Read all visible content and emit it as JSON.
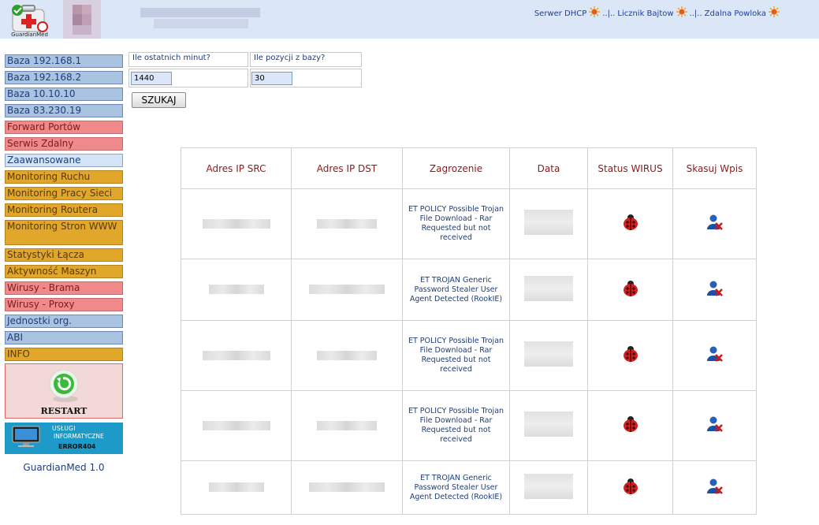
{
  "header": {
    "logo_text": "GuardianMed",
    "nav": [
      {
        "label": "Serwer DHCP"
      },
      {
        "label": "Licznik Bajtow"
      },
      {
        "label": "Zdalna Powloka"
      }
    ],
    "separator": "..|.."
  },
  "sidebar": {
    "items": [
      {
        "label": "Baza 192.168.1",
        "style": "blue"
      },
      {
        "label": "Baza 192.168.2",
        "style": "blue"
      },
      {
        "label": "Baza 10.10.10",
        "style": "blue"
      },
      {
        "label": "Baza 83.230.19",
        "style": "blue"
      },
      {
        "label": "Forward Portów",
        "style": "pink"
      },
      {
        "label": "Serwis Zdalny",
        "style": "pink"
      },
      {
        "label": "Zaawansowane",
        "style": "light"
      },
      {
        "label": "Monitoring Ruchu",
        "style": "gold"
      },
      {
        "label": "Monitoring Pracy Sieci",
        "style": "gold"
      },
      {
        "label": "Monitoring Routera",
        "style": "gold"
      },
      {
        "label": "Monitoring Stron WWW",
        "style": "gold"
      },
      {
        "label": "Statystyki Łącza",
        "style": "gold"
      },
      {
        "label": "Aktywność Maszyn",
        "style": "gold"
      },
      {
        "label": "Wirusy - Brama",
        "style": "pink"
      },
      {
        "label": "Wirusy - Proxy",
        "style": "pink"
      },
      {
        "label": "Jednostki org.",
        "style": "blue"
      },
      {
        "label": "ABI",
        "style": "blue"
      },
      {
        "label": "INFO",
        "style": "gold"
      }
    ],
    "restart_label": "RESTART",
    "banner": {
      "line1": "USŁUGI",
      "line2": "INFORMATYCZNE",
      "line3": "ERROR404"
    },
    "version": "GuardianMed 1.0"
  },
  "form": {
    "minutes_label": "Ile ostatnich minut?",
    "minutes_value": "1440",
    "positions_label": "Ile pozycji z bazy?",
    "positions_value": "30",
    "search_label": "SZUKAJ"
  },
  "table": {
    "headers": [
      "Adres IP SRC",
      "Adres IP DST",
      "Zagrozenie",
      "Data",
      "Status WIRUS",
      "Skasuj Wpis"
    ],
    "rows": [
      {
        "threat": "ET POLICY Possible Trojan File Download - Rar Requested but not received"
      },
      {
        "threat": "ET TROJAN Generic Password Stealer User Agent Detected (RookIE)"
      },
      {
        "threat": "ET POLICY Possible Trojan File Download - Rar Requested but not received"
      },
      {
        "threat": "ET POLICY Possible Trojan File Download - Rar Requested but not received"
      },
      {
        "threat": "ET TROJAN Generic Password Stealer User Agent Detected (RookIE)"
      }
    ]
  },
  "colors": {
    "header_bg": "#dbe6f7",
    "menu_blue": "#a9c3e1",
    "menu_pink": "#f08a8a",
    "menu_gold": "#e0a72a",
    "menu_light": "#d4e4f7",
    "th_text": "#8b1a1a",
    "link": "#1a3da8"
  },
  "icons": {
    "logo": "first-aid-kit-icon",
    "nav": "sun-icon",
    "restart": "green-restart-icon",
    "banner": "monitor-icon",
    "status": "ladybug-virus-icon",
    "delete": "user-delete-icon"
  }
}
